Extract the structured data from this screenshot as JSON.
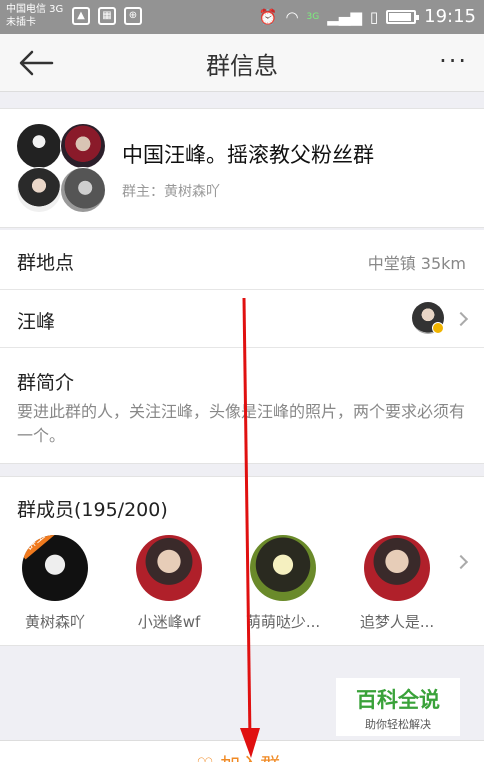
{
  "status_bar": {
    "carrier_line1": "中国电信 3G",
    "carrier_line2": "未插卡",
    "network_badge": "3G",
    "time": "19:15",
    "icons": [
      "screenshot-icon",
      "image-icon",
      "usb-icon",
      "alarm-icon",
      "wifi-icon",
      "signal-icon",
      "sim-icon",
      "battery-icon"
    ]
  },
  "nav": {
    "title": "群信息",
    "back_icon": "back-arrow-icon",
    "more_label": "···"
  },
  "group": {
    "name": "中国汪峰。摇滚教父粉丝群",
    "owner_label": "群主：黄树森吖"
  },
  "location": {
    "label": "群地点",
    "value": "中堂镇 35km"
  },
  "category": {
    "label": "汪峰"
  },
  "intro": {
    "label": "群简介",
    "text": "要进此群的人，关注汪峰，头像是汪峰的照片，两个要求必须有一个。"
  },
  "members": {
    "title": "群成员(195/200)",
    "owner_tag": "群主",
    "list": [
      {
        "name": "黄树森吖"
      },
      {
        "name": "小迷峰wf"
      },
      {
        "name": "萌萌哒少..."
      },
      {
        "name": "追梦人是..."
      }
    ]
  },
  "watermark": {
    "title": "百科全说",
    "subtitle": "助你轻松解决"
  },
  "bottom": {
    "join_label": "加入群"
  },
  "colors": {
    "status_bar": "#939393",
    "accent_orange": "#f08a24",
    "annotation_red": "#e01010",
    "watermark_green": "#3aa23a"
  }
}
